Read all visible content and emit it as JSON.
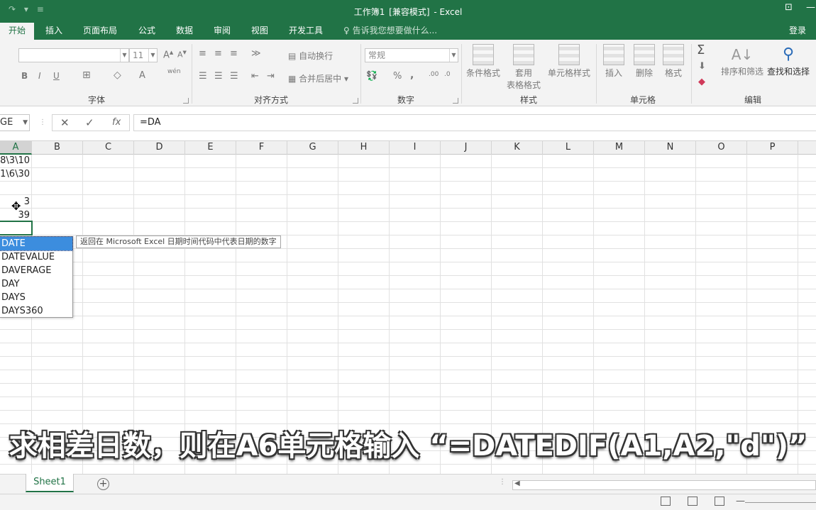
{
  "titlebar": {
    "title_doc": "工作簿1",
    "title_mode": "[兼容模式]",
    "title_app": "- Excel",
    "quick_access": "↷ ▾ ≡"
  },
  "tabs": [
    "开始",
    "插入",
    "页面布局",
    "公式",
    "数据",
    "审阅",
    "视图",
    "开发工具"
  ],
  "tell_me": "告诉我您想要做什么...",
  "login": "登录",
  "ribbon": {
    "font_size": "11",
    "number_format": "常规",
    "group_labels": {
      "font": "字体",
      "align": "对齐方式",
      "number": "数字",
      "styles": "样式",
      "cells": "单元格",
      "edit": "编辑"
    },
    "buttons": {
      "wrap_text": "自动换行",
      "merge_center": "合并后居中",
      "cond_format": "条件格式",
      "table_format_1": "套用",
      "table_format_2": "表格格式",
      "cell_styles": "单元格样式",
      "insert": "插入",
      "delete": "删除",
      "format": "格式",
      "sort_filter": "排序和筛选",
      "find_select": "查找和选择",
      "bold": "B",
      "italic": "I",
      "underline": "U",
      "wen": "wén",
      "percent": "%",
      "comma": ",",
      "sum": "Σ"
    }
  },
  "formula_bar": {
    "name_box": "GE",
    "cancel": "✕",
    "enter": "✓",
    "fx": "fx",
    "value": "=DA"
  },
  "columns": [
    "A",
    "B",
    "C",
    "D",
    "E",
    "F",
    "G",
    "H",
    "I",
    "J",
    "K",
    "L",
    "M",
    "N",
    "O",
    "P"
  ],
  "cells": {
    "a1": "8\\3\\10",
    "a2": "1\\6\\30",
    "a4": "3",
    "a5": "39"
  },
  "autocomplete": {
    "items": [
      "DATE",
      "DATEVALUE",
      "DAVERAGE",
      "DAY",
      "DAYS",
      "DAYS360"
    ],
    "tooltip": "返回在 Microsoft Excel 日期时间代码中代表日期的数字"
  },
  "subtitle": "求相差日数，则在A6单元格输入 “=DATEDIF(A1,A2,\"d\")”",
  "sheets": [
    "Sheet1"
  ],
  "add_sheet": "+"
}
